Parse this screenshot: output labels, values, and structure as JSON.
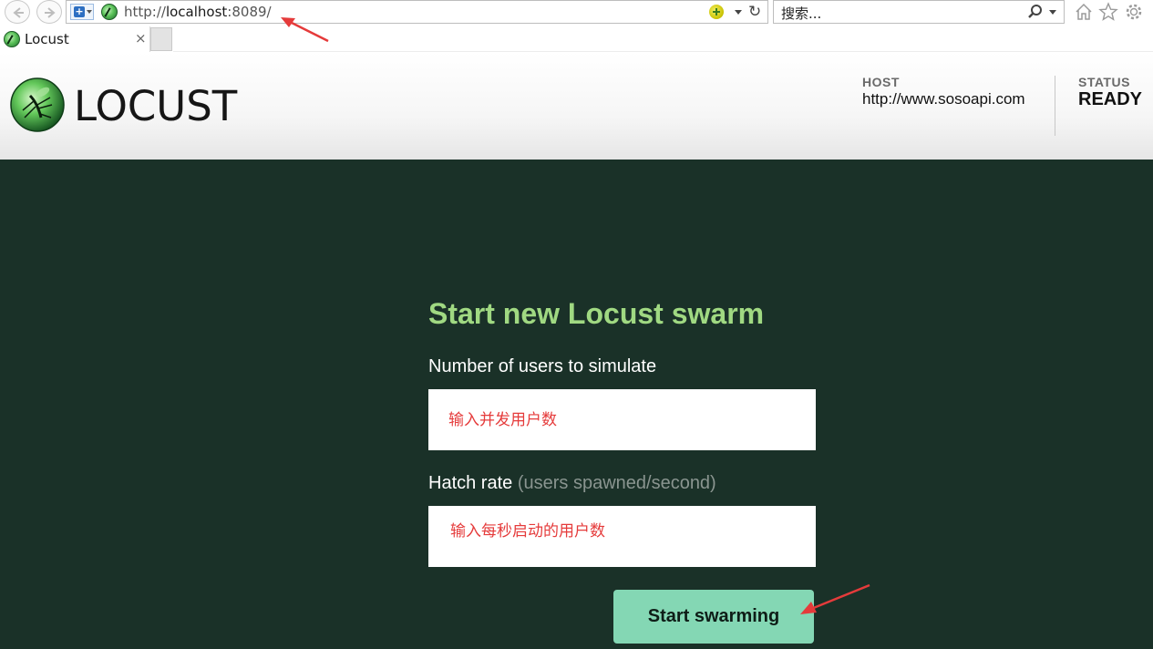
{
  "browser": {
    "address": {
      "scheme": "http://",
      "host": "localhost",
      "rest": ":8089/"
    },
    "search_placeholder": "搜索...",
    "tab": {
      "label": "Locust",
      "close": "×"
    }
  },
  "header": {
    "logo_text": "LOCUST",
    "host_label": "HOST",
    "host_value": "http://www.sosoapi.com",
    "status_label": "STATUS",
    "status_value": "READY"
  },
  "form": {
    "title": "Start new Locust swarm",
    "users_label": "Number of users to simulate",
    "users_note": "输入并发用户数",
    "rate_label": "Hatch rate",
    "rate_hint": "(users spawned/second)",
    "rate_note": "输入每秒启动的用户数",
    "submit_label": "Start swarming"
  },
  "colors": {
    "main_background": "#1a3128",
    "title": "#a0d982",
    "button": "#84d7b4",
    "annotation": "#e53b3b"
  },
  "icons": [
    "back-icon",
    "forward-icon",
    "shield-icon",
    "compat-icon",
    "refresh-icon",
    "search-icon",
    "home-icon",
    "star-icon",
    "gear-icon",
    "close-icon"
  ]
}
